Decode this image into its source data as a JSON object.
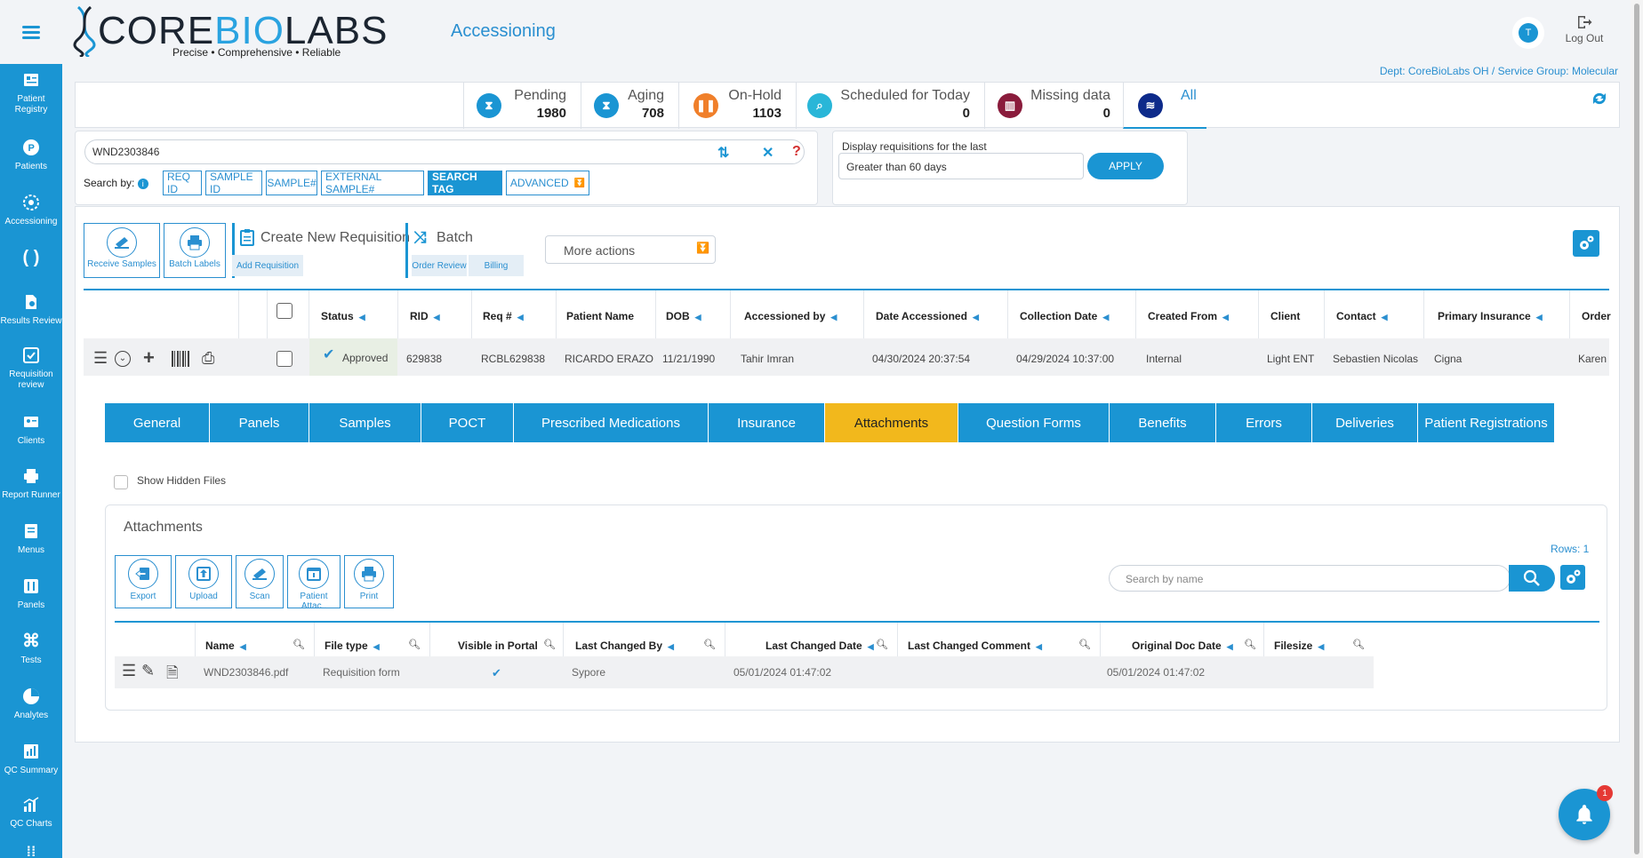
{
  "app": {
    "logo_part1": "CORE",
    "logo_part2": "BIO",
    "logo_part3": "LABS",
    "tagline": "Precise • Comprehensive • Reliable",
    "page_title": "Accessioning",
    "avatar_initial": "T",
    "logout_label": "Log Out",
    "dept": "Dept: CoreBioLabs OH / Service Group: Molecular"
  },
  "sidebar": {
    "items": [
      {
        "label1": "Patient",
        "label2": "Registry",
        "icon": "patient-registry-icon"
      },
      {
        "label1": "Patients",
        "label2": "",
        "icon": "patients-icon"
      },
      {
        "label1": "Accessioning",
        "label2": "",
        "icon": "accessioning-icon"
      },
      {
        "label1": "",
        "label2": "",
        "icon": "brackets-icon"
      },
      {
        "label1": "Results Review",
        "label2": "",
        "icon": "results-review-icon"
      },
      {
        "label1": "Requisition",
        "label2": "review",
        "icon": "requisition-review-icon"
      },
      {
        "label1": "Clients",
        "label2": "",
        "icon": "clients-icon"
      },
      {
        "label1": "Report Runner",
        "label2": "",
        "icon": "report-runner-icon"
      },
      {
        "label1": "Menus",
        "label2": "",
        "icon": "menus-icon"
      },
      {
        "label1": "Panels",
        "label2": "",
        "icon": "panels-icon"
      },
      {
        "label1": "Tests",
        "label2": "",
        "icon": "tests-icon"
      },
      {
        "label1": "Analytes",
        "label2": "",
        "icon": "analytes-icon"
      },
      {
        "label1": "QC Summary",
        "label2": "",
        "icon": "qc-summary-icon"
      },
      {
        "label1": "QC Charts",
        "label2": "",
        "icon": "qc-charts-icon"
      }
    ]
  },
  "status": {
    "pending": {
      "label": "Pending",
      "count": "1980"
    },
    "aging": {
      "label": "Aging",
      "count": "708"
    },
    "onhold": {
      "label": "On-Hold",
      "count": "1103"
    },
    "scheduled": {
      "label": "Scheduled for Today",
      "count": "0"
    },
    "missing": {
      "label": "Missing data",
      "count": "0"
    },
    "all": {
      "label": "All"
    }
  },
  "search": {
    "value": "WND2303846",
    "search_by_label": "Search by:",
    "buttons": [
      "REQ ID",
      "SAMPLE ID",
      "SAMPLE#",
      "EXTERNAL SAMPLE#",
      "SEARCH TAG",
      "ADVANCED"
    ]
  },
  "date_filter": {
    "label": "Display requisitions for the last",
    "value": "Greater than 60 days",
    "apply": "APPLY"
  },
  "toolbar": {
    "receive_samples": "Receive Samples",
    "batch_labels": "Batch Labels",
    "create_new_requisition": "Create New Requisition",
    "add_requisition": "Add Requisition",
    "batch": "Batch",
    "order_review": "Order Review",
    "billing": "Billing",
    "more_actions": "More actions"
  },
  "table": {
    "headers": [
      "Status",
      "RID",
      "Req #",
      "Patient Name",
      "DOB",
      "Accessioned by",
      "Date Accessioned",
      "Collection Date",
      "Created From",
      "Client",
      "Contact",
      "Primary Insurance",
      "Order"
    ],
    "row": {
      "status": "Approved",
      "rid": "629838",
      "req": "RCBL629838",
      "patient": "RICARDO ERAZO",
      "dob": "11/21/1990",
      "accessioned_by": "Tahir Imran",
      "date_accessioned": "04/30/2024 20:37:54",
      "collection_date": "04/29/2024 10:37:00",
      "created_from": "Internal",
      "client": "Light ENT",
      "contact": "Sebastien Nicolas",
      "insurance": "Cigna",
      "order": "Karen"
    }
  },
  "tabs": [
    "General",
    "Panels",
    "Samples",
    "POCT",
    "Prescribed Medications",
    "Insurance",
    "Attachments",
    "Question Forms",
    "Benefits",
    "Errors",
    "Deliveries",
    "Patient Registrations"
  ],
  "attachments": {
    "show_hidden_label": "Show Hidden Files",
    "title": "Attachments",
    "buttons": [
      "Export",
      "Upload",
      "Scan",
      "Patient Attac..",
      "Print"
    ],
    "rows_label": "Rows: 1",
    "search_placeholder": "Search by name",
    "headers": [
      "Name",
      "File type",
      "Visible in Portal",
      "Last Changed By",
      "Last Changed Date",
      "Last Changed Comment",
      "Original Doc Date",
      "Filesize"
    ],
    "row": {
      "name": "WND2303846.pdf",
      "file_type": "Requisition form",
      "visible": "✔",
      "changed_by": "Sypore",
      "changed_date": "05/01/2024 01:47:02",
      "comment": "",
      "original_date": "05/01/2024 01:47:02",
      "filesize": ""
    }
  },
  "notifications": {
    "count": "1"
  }
}
